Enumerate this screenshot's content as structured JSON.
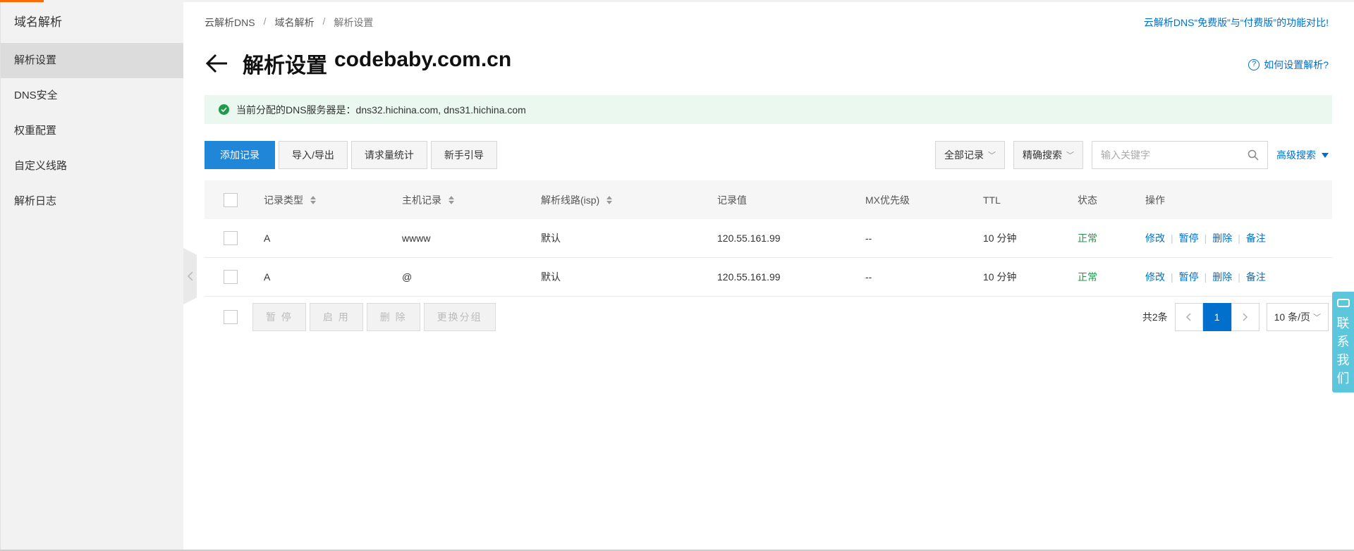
{
  "sidebar": {
    "title": "域名解析",
    "items": [
      {
        "label": "解析设置",
        "active": true
      },
      {
        "label": "DNS安全"
      },
      {
        "label": "权重配置"
      },
      {
        "label": "自定义线路"
      },
      {
        "label": "解析日志"
      }
    ]
  },
  "breadcrumb": [
    "云解析DNS",
    "域名解析",
    "解析设置"
  ],
  "compare_link": "云解析DNS“免费版”与“付费版”的功能对比!",
  "title": {
    "prefix": "解析设置",
    "domain": "codebaby.com.cn"
  },
  "help_link": "如何设置解析?",
  "notice": "当前分配的DNS服务器是：dns32.hichina.com, dns31.hichina.com",
  "toolbar": {
    "add": "添加记录",
    "import_export": "导入/导出",
    "stats": "请求量统计",
    "guide": "新手引导",
    "filter_select": "全部记录",
    "search_mode": "精确搜索",
    "search_placeholder": "输入关键字",
    "advanced": "高级搜索"
  },
  "table": {
    "headers": {
      "type": "记录类型",
      "host": "主机记录",
      "line": "解析线路(isp)",
      "value": "记录值",
      "mx": "MX优先级",
      "ttl": "TTL",
      "status": "状态",
      "ops": "操作"
    },
    "rows": [
      {
        "type": "A",
        "host": "wwww",
        "line": "默认",
        "value": "120.55.161.99",
        "mx": "--",
        "ttl": "10 分钟",
        "status": "正常"
      },
      {
        "type": "A",
        "host": "@",
        "line": "默认",
        "value": "120.55.161.99",
        "mx": "--",
        "ttl": "10 分钟",
        "status": "正常"
      }
    ],
    "ops": {
      "edit": "修改",
      "pause": "暂停",
      "delete": "删除",
      "remark": "备注"
    }
  },
  "batch": {
    "pause": "暂 停",
    "enable": "启 用",
    "delete": "删 除",
    "regroup": "更换分组"
  },
  "pager": {
    "total": "共2条",
    "current": "1",
    "page_size": "10 条/页"
  },
  "contact": [
    "联",
    "系",
    "我",
    "们"
  ],
  "colors": {
    "accent": "#ff6a00",
    "primary": "#1f86d8",
    "link": "#0070cc",
    "success": "#1e9b4b",
    "contact": "#5bc6dc"
  }
}
